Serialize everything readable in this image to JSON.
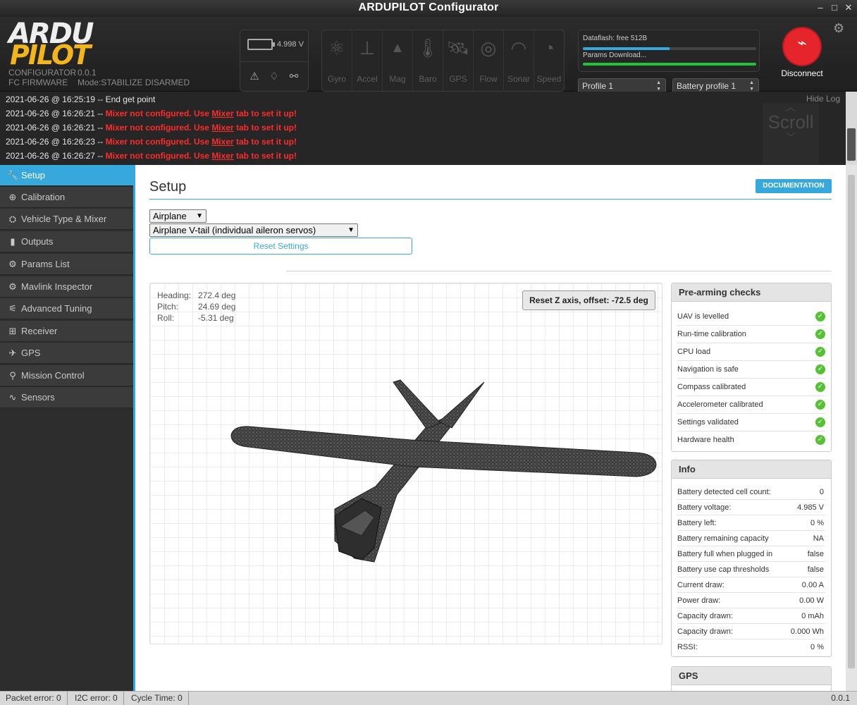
{
  "window": {
    "title": "ARDUPILOT Configurator"
  },
  "header": {
    "logo_top": "ARDU",
    "logo_bottom": "PILOT",
    "app_name": "CONFIGURATOR",
    "version": "0.0.1",
    "fc_label": "FC FIRMWARE",
    "mode": "Mode:STABILIZE DISARMED",
    "battery_voltage": "4.998 V",
    "sensors": [
      {
        "label": "Gyro",
        "icon": "gyro-icon"
      },
      {
        "label": "Accel",
        "icon": "accel-icon"
      },
      {
        "label": "Mag",
        "icon": "mag-icon"
      },
      {
        "label": "Baro",
        "icon": "baro-icon"
      },
      {
        "label": "GPS",
        "icon": "gps-icon"
      },
      {
        "label": "Flow",
        "icon": "flow-icon"
      },
      {
        "label": "Sonar",
        "icon": "sonar-icon"
      },
      {
        "label": "Speed",
        "icon": "speed-icon"
      }
    ],
    "dataflash": "Dataflash: free 512B",
    "params_download": "Params Download...",
    "dataflash_progress": 0.5,
    "params_progress": 1.0,
    "profile": "Profile 1",
    "battery_profile": "Battery profile 1",
    "disconnect": "Disconnect"
  },
  "log": {
    "hide_label": "Hide Log",
    "scroll_label": "Scroll",
    "first_line": {
      "time": "2021-06-26 @ 16:25:19",
      "text": "End get point"
    },
    "lines": [
      {
        "time": "2021-06-26 @ 16:26:21"
      },
      {
        "time": "2021-06-26 @ 16:26:21"
      },
      {
        "time": "2021-06-26 @ 16:26:23"
      },
      {
        "time": "2021-06-26 @ 16:26:27"
      }
    ],
    "err_a": "Mixer not configured. Use ",
    "err_link": "Mixer",
    "err_b": " tab to set it up!",
    "sep": " -- "
  },
  "sidebar": {
    "items": [
      {
        "label": "Setup",
        "icon": "wrench-icon",
        "active": true
      },
      {
        "label": "Calibration",
        "icon": "crosshair-icon"
      },
      {
        "label": "Vehicle Type & Mixer",
        "icon": "mixer-icon"
      },
      {
        "label": "Outputs",
        "icon": "outputs-icon"
      },
      {
        "label": "Params List",
        "icon": "gear-icon"
      },
      {
        "label": "Mavlink Inspector",
        "icon": "gear-icon"
      },
      {
        "label": "Advanced Tuning",
        "icon": "tuning-icon"
      },
      {
        "label": "Receiver",
        "icon": "receiver-icon"
      },
      {
        "label": "GPS",
        "icon": "satellite-icon"
      },
      {
        "label": "Mission Control",
        "icon": "map-pin-icon"
      },
      {
        "label": "Sensors",
        "icon": "pulse-icon"
      }
    ]
  },
  "setup": {
    "title": "Setup",
    "documentation": "DOCUMENTATION",
    "vehicle_type": "Airplane",
    "mixer_preset": "Airplane V-tail (individual aileron servos)",
    "reset_settings": "Reset Settings",
    "heading_label": "Heading:",
    "heading_value": "272.4 deg",
    "pitch_label": "Pitch:",
    "pitch_value": "24.69 deg",
    "roll_label": "Roll:",
    "roll_value": "-5.31 deg",
    "reset_z": "Reset Z axis, offset: -72.5 deg"
  },
  "prearm": {
    "title": "Pre-arming checks",
    "checks": [
      "UAV is levelled",
      "Run-time calibration",
      "CPU load",
      "Navigation is safe",
      "Compass calibrated",
      "Accelerometer calibrated",
      "Settings validated",
      "Hardware health"
    ]
  },
  "info": {
    "title": "Info",
    "rows": [
      {
        "label": "Battery detected cell count:",
        "value": "0"
      },
      {
        "label": "Battery voltage:",
        "value": "4.985 V"
      },
      {
        "label": "Battery left:",
        "value": "0 %"
      },
      {
        "label": "Battery remaining capacity",
        "value": "NA"
      },
      {
        "label": "Battery full when plugged in",
        "value": "false"
      },
      {
        "label": "Battery use cap thresholds",
        "value": "false"
      },
      {
        "label": "Current draw:",
        "value": "0.00 A"
      },
      {
        "label": "Power draw:",
        "value": "0.00 W"
      },
      {
        "label": "Capacity drawn:",
        "value": "0 mAh"
      },
      {
        "label": "Capacity drawn:",
        "value": "0.000 Wh"
      },
      {
        "label": "RSSI:",
        "value": "0 %"
      }
    ]
  },
  "gps_panel": {
    "title": "GPS"
  },
  "statusbar": {
    "packet_error": "Packet error: 0",
    "i2c_error": "I2C error: 0",
    "cycle_time": "Cycle Time: 0",
    "version": "0.0.1"
  },
  "colors": {
    "accent": "#37a8db",
    "error": "#ff2b2b",
    "ok": "#55c234",
    "disconnect": "#e5242c",
    "logo": "#f3b51b"
  }
}
